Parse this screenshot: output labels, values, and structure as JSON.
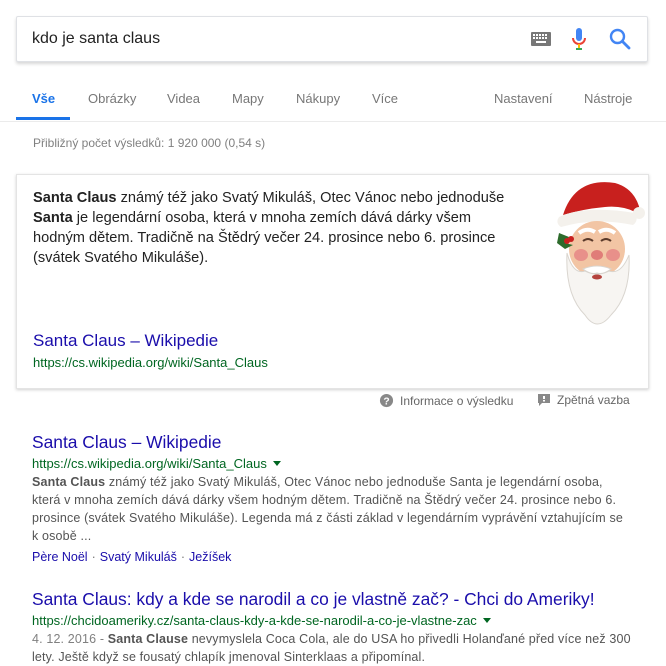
{
  "search": {
    "query": "kdo je santa claus"
  },
  "tabs": {
    "items": [
      "Vše",
      "Obrázky",
      "Videa",
      "Mapy",
      "Nákupy",
      "Více"
    ],
    "right": [
      "Nastavení",
      "Nástroje"
    ]
  },
  "result_stats": "Přibližný počet výsledků: 1 920 000 (0,54 s)",
  "knowledge_panel": {
    "desc_b1": "Santa Claus",
    "desc_t1": " známý též jako Svatý Mikuláš, Otec Vánoc nebo jednoduše ",
    "desc_b2": "Santa",
    "desc_t2": " je legendární osoba, která v mnoha zemích dává dárky všem hodným dětem. Tradičně na Štědrý večer 24. prosince nebo 6. prosince (svátek Svatého Mikuláše).",
    "link_title": "Santa Claus – Wikipedie",
    "link_url": "https://cs.wikipedia.org/wiki/Santa_Claus",
    "info_label": "Informace o výsledku",
    "feedback_label": "Zpětná vazba"
  },
  "results": [
    {
      "title": "Santa Claus – Wikipedie",
      "url": "https://cs.wikipedia.org/wiki/Santa_Claus",
      "snippet_b1": "Santa Claus",
      "snippet_t1": " známý též jako Svatý Mikuláš, Otec Vánoc nebo jednoduše Santa je legendární osoba, která v mnoha zemích dává dárky všem hodným dětem. Tradičně na Štědrý večer 24. prosince nebo 6. prosince (svátek Svatého Mikuláše). Legenda má z části základ v legendárním vyprávění vztahujícím se k osobě ...",
      "sitelinks": [
        "Père Noël",
        "Svatý Mikuláš",
        "Ježíšek"
      ]
    },
    {
      "title": "Santa Claus: kdy a kde se narodil a co je vlastně zač? - Chci do Ameriky!",
      "url": "https://chcidoameriky.cz/santa-claus-kdy-a-kde-se-narodil-a-co-je-vlastne-zac",
      "date": "4. 12. 2016 - ",
      "snippet_b1": "Santa Clause",
      "snippet_t1": " nevymyslela Coca Cola, ale do USA ho přivedli Holanďané před více než 300 lety. Ještě když se fousatý chlapík jmenoval Sinterklaas a připomínal."
    }
  ],
  "colors": {
    "link": "#1a0dab",
    "url_green": "#006621",
    "accent_blue": "#1a73e8"
  }
}
